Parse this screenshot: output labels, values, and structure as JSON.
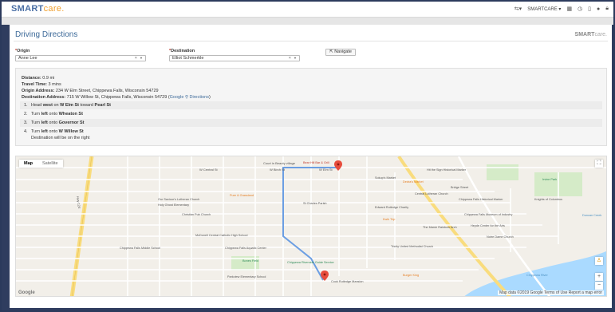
{
  "app": {
    "logo_sm": "SM",
    "logo_art": "ART",
    "logo_care": "care.",
    "user_menu": "SMARTCARE ▾"
  },
  "page": {
    "title": "Driving Directions",
    "brand_sm": "SMART",
    "brand_care": "care."
  },
  "form": {
    "origin_label": "Origin",
    "origin_value": "Anne Lee",
    "destination_label": "Destination",
    "destination_value": "Elliot Schmerkle",
    "navigate_label": "Navigate"
  },
  "summary": {
    "distance_label": "Distance:",
    "distance_value": "0.9 mi",
    "time_label": "Travel Time:",
    "time_value": "3 mins",
    "origin_address_label": "Origin Address:",
    "origin_address_value": "234 W Elm Street, Chippewa Falls, Wisconsin 54729",
    "dest_address_label": "Destination Address:",
    "dest_address_value": "715 W Willow St, Chippewa Falls, Wisconsin 54729 (",
    "google_link": "Google",
    "directions_link": "Directions",
    "close_paren": ")"
  },
  "steps": [
    {
      "num": "1.",
      "pre": "Head ",
      "b1": "west",
      "mid": " on ",
      "b2": "W Elm St",
      "post": " toward ",
      "b3": "Pearl St"
    },
    {
      "num": "2.",
      "pre": "Turn ",
      "b1": "left",
      "mid": " onto ",
      "b2": "Wheaton St",
      "post": "",
      "b3": ""
    },
    {
      "num": "3.",
      "pre": "Turn ",
      "b1": "left",
      "mid": " onto ",
      "b2": "Governor St",
      "post": "",
      "b3": ""
    },
    {
      "num": "4.",
      "pre": "Turn ",
      "b1": "left",
      "mid": " onto ",
      "b2": "W Willow St",
      "post": "",
      "b3": ""
    }
  ],
  "step4_note": "Destination will be on the right",
  "map": {
    "tab_map": "Map",
    "tab_satellite": "Satellite",
    "footer": "Map data ©2019 Google   Terms of Use   Report a map error",
    "google": "Google",
    "labels": {
      "court_beauty": "Court in Beauty village",
      "bear_hill": "Bear Hill Bar & Grill",
      "w_birch": "W Birch St",
      "w_elm": "W Elm St",
      "w_central": "W Central St",
      "pure_and": "Pure & Grassland",
      "hwy124": "Hwy 124",
      "notre_dame": "Our Saviour's Lutheran Church",
      "holy_ghost": "Holy Ghost Elementary",
      "christian_church": "Christian Pub Church",
      "mcdonell": "McDonell Central Catholic High School",
      "chippewa_middle": "Chippewa Falls Middle School",
      "chippewa_pool": "Chippewa Falls Aquatic Center",
      "bones_field": "Bones Field",
      "parkview": "Parkview Elementary School",
      "chippewa_guide": "Chippewa Riverside Guide Service",
      "cook_mansion": "Cook Rutledge Mansion",
      "st_charles": "St Charles Parish",
      "dedra": "Dedra's Market",
      "sokup": "Sokup's Market",
      "central_lutheran": "Central Lutheran Church",
      "edward": "Edward Rutledge Charity",
      "chippewa_museum": "Chippewa Falls Museum of Industry",
      "heyde": "Heyde Center for the Arts",
      "marsh": "The Marsh Rainbow Arch",
      "notre": "Notre Dame Church",
      "kwik": "Kwik Trip",
      "irvine": "Irvine Park",
      "bridge": "Bridge Street",
      "knights": "Knights of Columbus",
      "bergen": "Burger King",
      "chip_hist": "Chippewa Falls Historical Marker",
      "old_hist": "Hit the Sign Historical Marker",
      "trinity": "Trinity United Methodist Church",
      "duncan": "Duncan Creek",
      "chip_river": "Chippewa River"
    }
  }
}
